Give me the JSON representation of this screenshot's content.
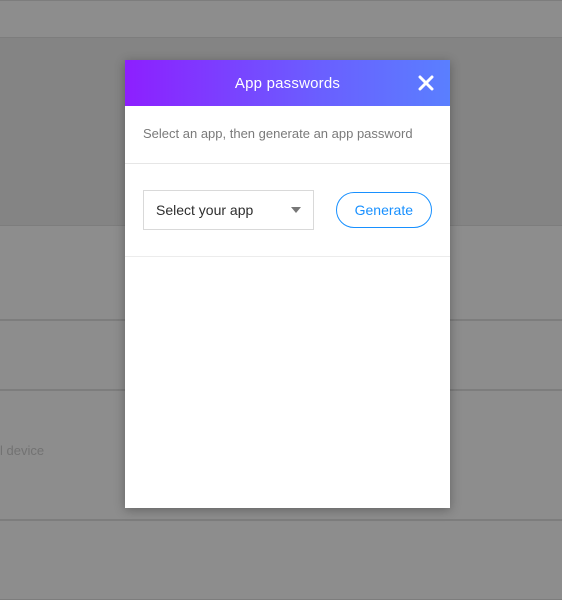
{
  "background": {
    "partial_text": "l device"
  },
  "modal": {
    "title": "App passwords",
    "instruction": "Select an app, then generate an app password",
    "select": {
      "placeholder": "Select your app"
    },
    "generate_label": "Generate"
  }
}
